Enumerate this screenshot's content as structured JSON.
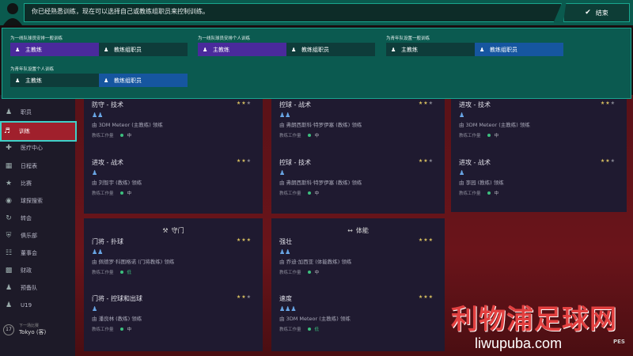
{
  "banner": {
    "message": "你已经熟悉训练，现在可以选择自己或教练组职员来控制训练。",
    "finish_label": "结束"
  },
  "assign_groups": [
    {
      "label": "为一线队球员安排一般训练",
      "options": [
        "主教练",
        "教练组职员"
      ],
      "selected": 0
    },
    {
      "label": "为一线队球员安排个人训练",
      "options": [
        "主教练",
        "教练组职员"
      ],
      "selected": 0
    },
    {
      "label": "为青年队设置一般训练",
      "options": [
        "主教练",
        "教练组职员"
      ],
      "selected": 1
    },
    {
      "label": "为青年队设置个人训练",
      "options": [
        "主教练",
        "教练组职员"
      ],
      "selected": 1
    }
  ],
  "sidebar": {
    "items": [
      {
        "label": "职员",
        "icon": "people-icon"
      },
      {
        "label": "训练",
        "icon": "training-icon",
        "active": true
      },
      {
        "label": "医疗中心",
        "icon": "medical-icon"
      },
      {
        "label": "日程表",
        "icon": "calendar-icon"
      },
      {
        "label": "比赛",
        "icon": "trophy-icon"
      },
      {
        "label": "球探搜索",
        "icon": "binoculars-icon"
      },
      {
        "label": "转会",
        "icon": "transfer-icon"
      },
      {
        "label": "俱乐部",
        "icon": "shield-icon"
      },
      {
        "label": "董事会",
        "icon": "board-icon"
      },
      {
        "label": "财政",
        "icon": "money-icon"
      },
      {
        "label": "预备队",
        "icon": "reserve-icon"
      },
      {
        "label": "U19",
        "icon": "u19-icon"
      }
    ],
    "next_match_label": "下一场比赛",
    "next_match_value": "Tokyo (客)",
    "next_match_days": "17"
  },
  "cards": {
    "defense": {
      "header": "",
      "sessions": [
        {
          "title": "防守 - 技术",
          "stars": 2,
          "players": 2,
          "by": "由 3DM Meteor (主教练) 领练",
          "load_label": "教练工作量",
          "load": "中"
        },
        {
          "title": "进攻 - 战术",
          "stars": 2,
          "players": 1,
          "by": "由 刘智宇 (教练) 领练",
          "load_label": "教练工作量",
          "load": "中"
        }
      ]
    },
    "control": {
      "header": "",
      "sessions": [
        {
          "title": "控球 - 战术",
          "stars": 2,
          "players": 2,
          "by": "由 弗朗西斯科·特罗伊塞 (教练) 领练",
          "load_label": "教练工作量",
          "load": "中"
        },
        {
          "title": "控球 - 技术",
          "stars": 2,
          "players": 1,
          "by": "由 弗朗西斯科·特罗伊塞 (教练) 领练",
          "load_label": "教练工作量",
          "load": "中"
        }
      ]
    },
    "attack": {
      "header": "",
      "sessions": [
        {
          "title": "进攻 - 技术",
          "stars": 2,
          "players": 1,
          "by": "由 3DM Meteor (主教练) 领练",
          "load_label": "教练工作量",
          "load": "中"
        },
        {
          "title": "进攻 - 战术",
          "stars": 2,
          "players": 1,
          "by": "由 李园 (教练) 领练",
          "load_label": "教练工作量",
          "load": "中"
        }
      ]
    },
    "goalkeeping": {
      "header": "守门",
      "sessions": [
        {
          "title": "门将 - 扑球",
          "stars": 3,
          "players": 2,
          "by": "由 佩德罗·科图格诺 (门将教练) 领练",
          "load_label": "教练工作量",
          "load": "低"
        },
        {
          "title": "门将 - 控球和出球",
          "stars": 2,
          "players": 1,
          "by": "由 潘良林 (教练) 领练",
          "load_label": "教练工作量",
          "load": "中"
        }
      ]
    },
    "fitness": {
      "header": "体能",
      "sessions": [
        {
          "title": "强壮",
          "stars": 3,
          "players": 2,
          "by": "由 乔迪·加西亚 (体能教练) 领练",
          "load_label": "教练工作量",
          "load": "中"
        },
        {
          "title": "速度",
          "stars": 3,
          "players": 3,
          "by": "由 3DM Meteor (主教练) 领练",
          "load_label": "教练工作量",
          "load": "低"
        }
      ]
    }
  },
  "watermark": {
    "main": "利物浦足球网",
    "sub": "liwupuba.com",
    "corner": "PES"
  },
  "colors": {
    "accent": "#19a58e",
    "active_red": "#a0202c",
    "purple": "#4a2a9c",
    "blue": "#1656a0",
    "star": "#d8c060",
    "dot": "#3cc07e"
  }
}
